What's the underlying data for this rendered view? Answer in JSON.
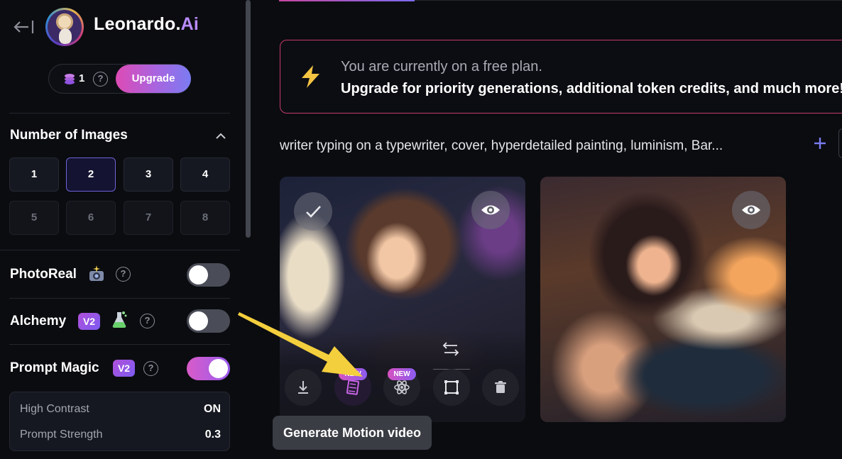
{
  "app": {
    "brand_name": "Leonardo.",
    "brand_suffix": "Ai",
    "accent_color": "#b98bff"
  },
  "account": {
    "token_count": "1",
    "upgrade_label": "Upgrade"
  },
  "number_of_images": {
    "title": "Number of Images",
    "options": [
      "1",
      "2",
      "3",
      "4",
      "5",
      "6",
      "7",
      "8"
    ],
    "selected": "2"
  },
  "settings": {
    "photoreal_label": "PhotoReal",
    "alchemy_label": "Alchemy",
    "alchemy_badge": "V2",
    "prompt_magic_label": "Prompt Magic",
    "prompt_magic_badge": "V2",
    "photoreal_on": false,
    "alchemy_on": false,
    "prompt_magic_on": true,
    "high_contrast_label": "High Contrast",
    "high_contrast_value": "ON",
    "prompt_strength_label": "Prompt Strength",
    "prompt_strength_value": "0.3"
  },
  "banner": {
    "line1": "You are currently on a free plan.",
    "line2": "Upgrade for priority generations, additional token credits, and much more!",
    "border_color": "#c23c6a"
  },
  "generation": {
    "prompt": "writer typing on a typewriter, cover, hyperdetailed painting, luminism, Bar...",
    "new_badge": "NEW",
    "tooltip": "Generate Motion video",
    "icons": [
      "download-icon",
      "motion-video-icon",
      "atom-icon",
      "crop-icon",
      "trash-icon",
      "swap-icon",
      "eye-icon",
      "check-icon"
    ]
  },
  "annotation": {
    "arrow_color": "#f4cf3d"
  }
}
